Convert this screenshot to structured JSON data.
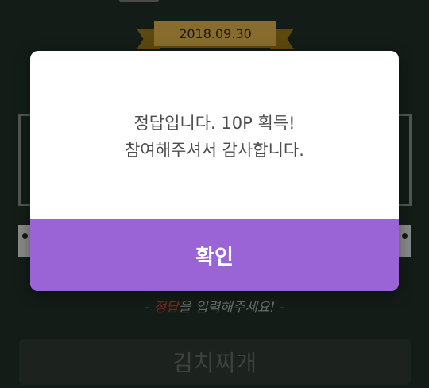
{
  "background": {
    "date_ribbon": "2018.09.30",
    "hint": {
      "prefix": "- ",
      "accent": "정답",
      "rest": "을 입력해주세요!",
      "suffix": " -"
    },
    "answer_value": "김치찌개"
  },
  "dialog": {
    "line1": "정답입니다. 10P 획득!",
    "line2": "참여해주셔서 감사합니다.",
    "confirm_label": "확인"
  },
  "colors": {
    "accent_purple": "#9b64d6",
    "ribbon_gold": "#c7a043",
    "hint_red": "#c0392b"
  }
}
